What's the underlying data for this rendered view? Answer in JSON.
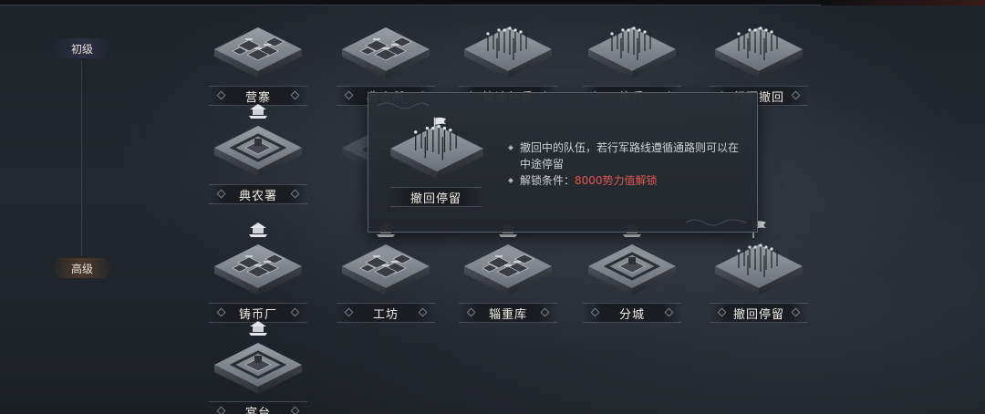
{
  "tiers": {
    "basic": "初级",
    "advanced": "高级"
  },
  "buildings": {
    "row1": [
      {
        "label": "营寨",
        "icon": "camp-icon"
      },
      {
        "label": "典农所",
        "icon": "farm-office-icon"
      },
      {
        "label": "快速征兵",
        "icon": "conscription-icon"
      },
      {
        "label": "练兵",
        "icon": "training-icon"
      },
      {
        "label": "行军撤回",
        "icon": "march-retreat-icon"
      }
    ],
    "row2": [
      {
        "label": "典农署",
        "icon": "farm-bureau-icon"
      }
    ],
    "row3": [
      {
        "label": "铸币厂",
        "icon": "mint-icon"
      },
      {
        "label": "工坊",
        "icon": "workshop-icon"
      },
      {
        "label": "辎重库",
        "icon": "supply-depot-icon"
      },
      {
        "label": "分城",
        "icon": "branch-city-icon"
      },
      {
        "label": "撤回停留",
        "icon": "retreat-stay-icon"
      }
    ],
    "row4": [
      {
        "label": "宴台",
        "icon": "banquet-stage-icon"
      }
    ]
  },
  "tooltip": {
    "title": "撤回停留",
    "desc": "撤回中的队伍，若行军路线遵循通路则可以在中途停留",
    "unlock_prefix": "解锁条件：",
    "unlock_value": "8000势力值解锁"
  },
  "colors": {
    "unlock_condition": "#e0584f",
    "tier_basic_bg": "#2e2f44",
    "tier_advanced_bg": "#4b3a2a"
  }
}
